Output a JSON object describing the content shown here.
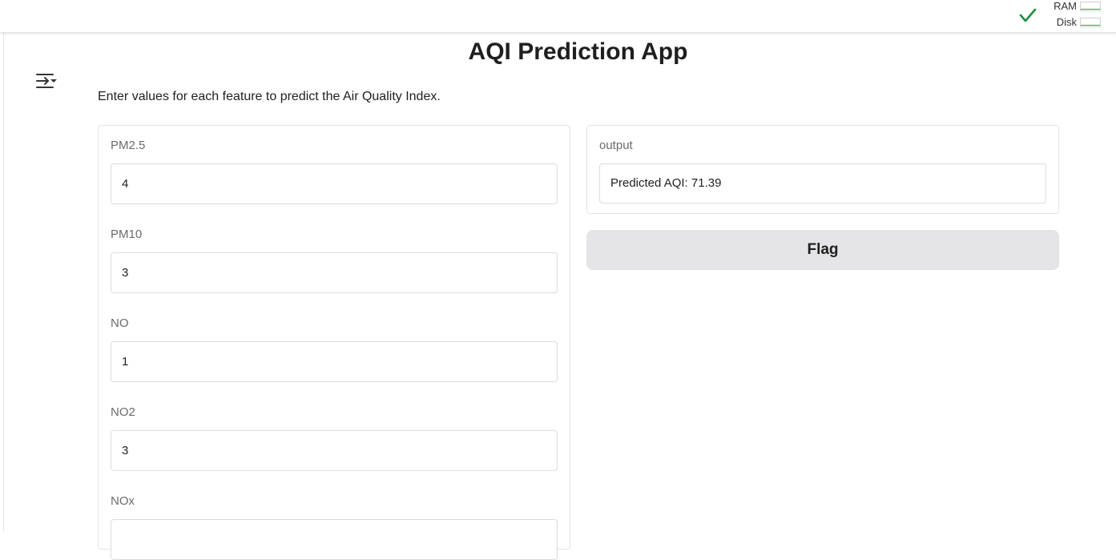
{
  "header": {
    "status_icon": "check-icon",
    "metrics": [
      {
        "label": "RAM",
        "level": 0.05
      },
      {
        "label": "Disk",
        "level": 0.05
      }
    ],
    "accent_color": "#2e9e4f"
  },
  "sidebar_toggle": {
    "icon": "sidebar-toggle-icon"
  },
  "app": {
    "title": "AQI Prediction App",
    "description": "Enter values for each feature to predict the Air Quality Index."
  },
  "inputs": [
    {
      "label": "PM2.5",
      "value": "4"
    },
    {
      "label": "PM10",
      "value": "3"
    },
    {
      "label": "NO",
      "value": "1"
    },
    {
      "label": "NO2",
      "value": "3"
    },
    {
      "label": "NOx",
      "value": ""
    }
  ],
  "output": {
    "label": "output",
    "value": "Predicted AQI: 71.39"
  },
  "flag_button": {
    "label": "Flag"
  }
}
